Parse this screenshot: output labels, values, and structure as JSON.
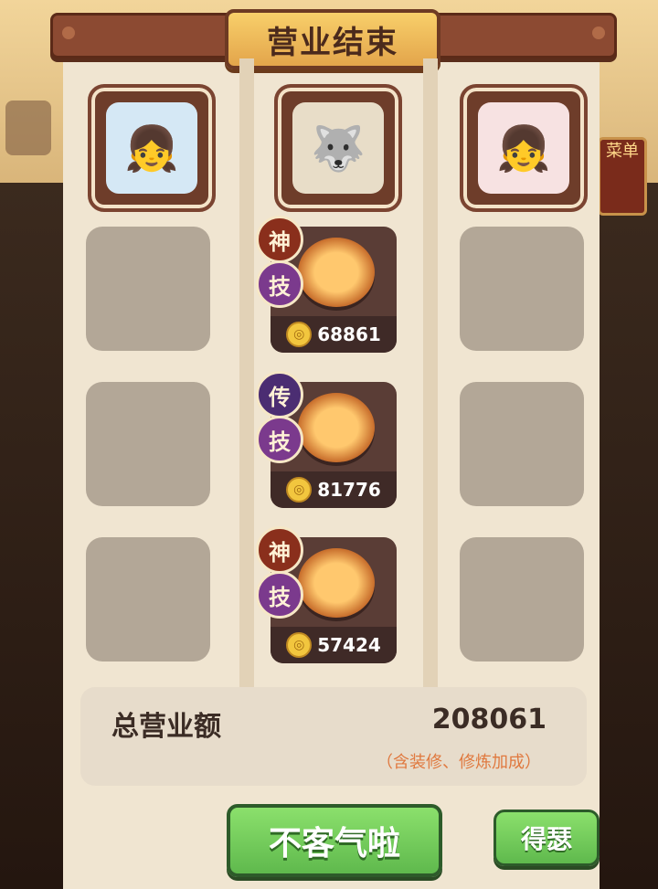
{
  "title": "营业结束",
  "avatars": [
    {
      "name": "girl-with-bows-avatar",
      "emoji": "👧"
    },
    {
      "name": "wolf-chef-avatar",
      "emoji": "🐺"
    },
    {
      "name": "girl-with-apples-avatar",
      "emoji": "👧"
    }
  ],
  "dishes": [
    {
      "badge_top": "神",
      "badge_skill": "技",
      "price": "68861",
      "icon": "soup-bowl-icon"
    },
    {
      "badge_top": "传",
      "badge_skill": "技",
      "price": "81776",
      "icon": "fish-dish-icon"
    },
    {
      "badge_top": "神",
      "badge_skill": "技",
      "price": "57424",
      "icon": "grilled-dish-icon"
    }
  ],
  "coin_symbol": "◎",
  "total": {
    "label": "总营业额",
    "value": "208061",
    "note": "（含装修、修炼加成）"
  },
  "buttons": {
    "confirm": "不客气啦",
    "brag": "得瑟"
  },
  "background": {
    "side_button": "菜单"
  }
}
